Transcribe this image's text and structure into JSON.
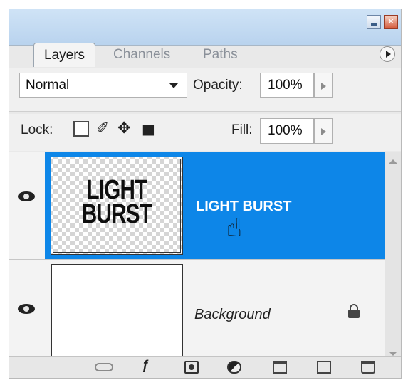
{
  "tabs": {
    "layers": "Layers",
    "channels": "Channels",
    "paths": "Paths"
  },
  "options": {
    "blend_mode": "Normal",
    "opacity_label": "Opacity:",
    "opacity_value": "100%",
    "lock_label": "Lock:",
    "fill_label": "Fill:",
    "fill_value": "100%"
  },
  "layers": [
    {
      "name": "LIGHT BURST",
      "thumb_text_line1": "LIGHT",
      "thumb_text_line2": "BURST",
      "selected": true,
      "visible": true
    },
    {
      "name": "Background",
      "locked": true,
      "visible": true
    }
  ],
  "colors": {
    "selection": "#0d86e8",
    "panel_bg": "#e9e9e9",
    "header": "#c3d9f0"
  },
  "icons": [
    "minimize-icon",
    "close-icon",
    "panel-menu-icon",
    "eye-icon",
    "padlock-icon",
    "hand-cursor-icon",
    "link-icon",
    "fx-icon",
    "mask-icon",
    "adjustment-icon",
    "group-icon",
    "new-layer-icon",
    "trash-icon"
  ]
}
